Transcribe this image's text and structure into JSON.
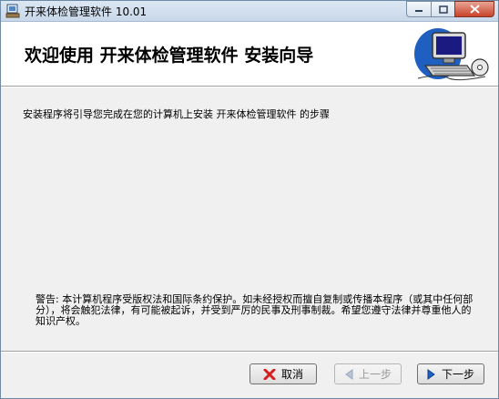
{
  "window": {
    "title": "开来体检管理软件 10.01",
    "controls": [
      "minimize-icon",
      "maximize-icon",
      "close-icon"
    ]
  },
  "header": {
    "title": "欢迎使用 开来体检管理软件 安装向导",
    "graphic_icon": "computer-installer-icon"
  },
  "body": {
    "intro": "安装程序将引导您完成在您的计算机上安装 开来体检管理软件 的步骤",
    "warning": "警告: 本计算机程序受版权法和国际条约保护。如未经授权而擅自复制或传播本程序（或其中任何部分），将会触犯法律，有可能被起诉，并受到严厉的民事及刑事制裁。希望您遵守法律并尊重他人的知识产权。"
  },
  "buttons": {
    "cancel": {
      "label": "取消",
      "icon": "red-x-icon",
      "enabled": true
    },
    "prev": {
      "label": "上一步",
      "icon": "left-arrow-icon",
      "enabled": false
    },
    "next": {
      "label": "下一步",
      "icon": "right-arrow-icon",
      "enabled": true
    }
  },
  "colors": {
    "accent_blue": "#1f5fbf",
    "cancel_red": "#d42020"
  }
}
